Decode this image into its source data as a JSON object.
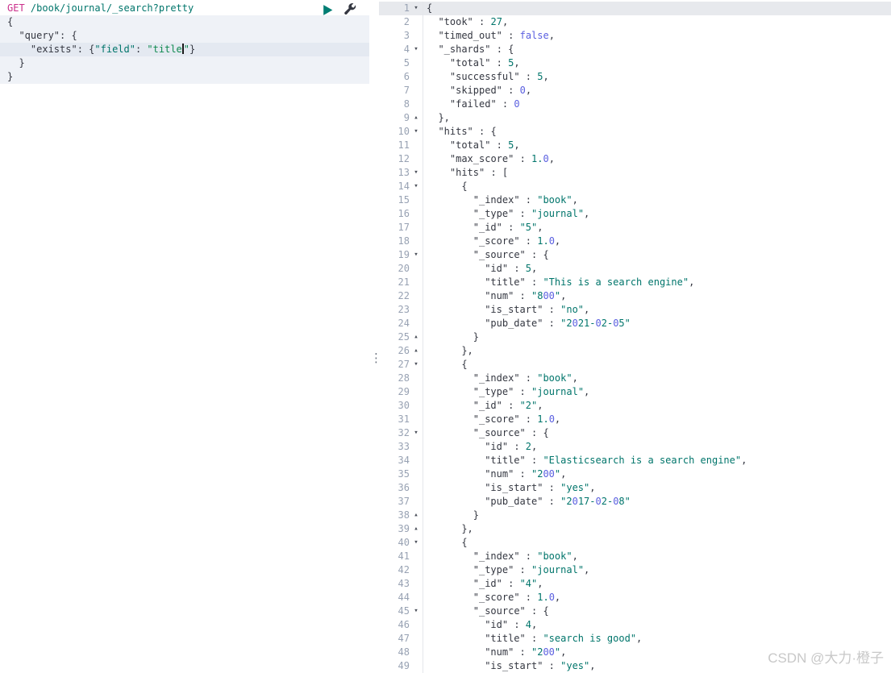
{
  "colors": {
    "method_pink": "#CB2F8B",
    "url_teal": "#00756B",
    "key_dark": "#343741",
    "string_teal": "#00756B",
    "string_green": "#108A50",
    "constant_violet": "#5A5FE0",
    "line_number_grey": "#98A2B3",
    "active_line_bg": "#E7E9ED",
    "play_green": "#017D73"
  },
  "icons": {
    "fold_open": "▾",
    "fold_close": "▴",
    "divider_handle": "⋮",
    "send_request": "play-triangle",
    "settings": "wrench"
  },
  "watermark": "CSDN @大力·橙子",
  "left_editor": {
    "lines": [
      {
        "tokens": [
          [
            "m",
            "GET"
          ],
          [
            "p",
            " "
          ],
          [
            "u",
            "/book/journal/_search?pretty"
          ]
        ]
      },
      {
        "tint": true,
        "tokens": [
          [
            "p",
            "{"
          ]
        ]
      },
      {
        "tint": true,
        "tokens": [
          [
            "p",
            "  "
          ],
          [
            "k",
            "\"query\""
          ],
          [
            "p",
            ": {"
          ]
        ]
      },
      {
        "tint": true,
        "active": true,
        "tokens": [
          [
            "p",
            "    "
          ],
          [
            "k",
            "\"exists\""
          ],
          [
            "p",
            ": {"
          ],
          [
            "f",
            "\"field\""
          ],
          [
            "p",
            ": "
          ],
          [
            "g",
            "\"title"
          ],
          [
            "c",
            ""
          ],
          [
            "g",
            "\""
          ],
          [
            "p",
            "}"
          ]
        ]
      },
      {
        "tint": true,
        "tokens": [
          [
            "p",
            "  }"
          ]
        ]
      },
      {
        "tint": true,
        "tokens": [
          [
            "p",
            "}"
          ]
        ]
      }
    ]
  },
  "right_editor": {
    "lines": [
      {
        "n": 1,
        "fold": "open",
        "indent": 0,
        "active": true,
        "tokens": [
          [
            "p",
            "{"
          ]
        ]
      },
      {
        "n": 2,
        "indent": 2,
        "tokens": [
          [
            "k",
            "\"took\""
          ],
          [
            "p",
            " : "
          ],
          [
            "n",
            "27"
          ],
          [
            "p",
            ","
          ]
        ]
      },
      {
        "n": 3,
        "indent": 2,
        "tokens": [
          [
            "k",
            "\"timed_out\""
          ],
          [
            "p",
            " : "
          ],
          [
            "b",
            "false"
          ],
          [
            "p",
            ","
          ]
        ]
      },
      {
        "n": 4,
        "fold": "open",
        "indent": 2,
        "tokens": [
          [
            "k",
            "\"_shards\""
          ],
          [
            "p",
            " : {"
          ]
        ]
      },
      {
        "n": 5,
        "indent": 4,
        "tokens": [
          [
            "k",
            "\"total\""
          ],
          [
            "p",
            " : "
          ],
          [
            "n",
            "5"
          ],
          [
            "p",
            ","
          ]
        ]
      },
      {
        "n": 6,
        "indent": 4,
        "tokens": [
          [
            "k",
            "\"successful\""
          ],
          [
            "p",
            " : "
          ],
          [
            "n",
            "5"
          ],
          [
            "p",
            ","
          ]
        ]
      },
      {
        "n": 7,
        "indent": 4,
        "tokens": [
          [
            "k",
            "\"skipped\""
          ],
          [
            "p",
            " : "
          ],
          [
            "n",
            "0"
          ],
          [
            "p",
            ","
          ]
        ]
      },
      {
        "n": 8,
        "indent": 4,
        "tokens": [
          [
            "k",
            "\"failed\""
          ],
          [
            "p",
            " : "
          ],
          [
            "n",
            "0"
          ]
        ]
      },
      {
        "n": 9,
        "fold": "close",
        "indent": 2,
        "tokens": [
          [
            "p",
            "},"
          ]
        ]
      },
      {
        "n": 10,
        "fold": "open",
        "indent": 2,
        "tokens": [
          [
            "k",
            "\"hits\""
          ],
          [
            "p",
            " : {"
          ]
        ]
      },
      {
        "n": 11,
        "indent": 4,
        "tokens": [
          [
            "k",
            "\"total\""
          ],
          [
            "p",
            " : "
          ],
          [
            "n",
            "5"
          ],
          [
            "p",
            ","
          ]
        ]
      },
      {
        "n": 12,
        "indent": 4,
        "tokens": [
          [
            "k",
            "\"max_score\""
          ],
          [
            "p",
            " : "
          ],
          [
            "n",
            "1.0"
          ],
          [
            "p",
            ","
          ]
        ]
      },
      {
        "n": 13,
        "fold": "open",
        "indent": 4,
        "tokens": [
          [
            "k",
            "\"hits\""
          ],
          [
            "p",
            " : ["
          ]
        ]
      },
      {
        "n": 14,
        "fold": "open",
        "indent": 6,
        "tokens": [
          [
            "p",
            "{"
          ]
        ]
      },
      {
        "n": 15,
        "indent": 8,
        "tokens": [
          [
            "k",
            "\"_index\""
          ],
          [
            "p",
            " : "
          ],
          [
            "s",
            "\"book\""
          ],
          [
            "p",
            ","
          ]
        ]
      },
      {
        "n": 16,
        "indent": 8,
        "tokens": [
          [
            "k",
            "\"_type\""
          ],
          [
            "p",
            " : "
          ],
          [
            "s",
            "\"journal\""
          ],
          [
            "p",
            ","
          ]
        ]
      },
      {
        "n": 17,
        "indent": 8,
        "tokens": [
          [
            "k",
            "\"_id\""
          ],
          [
            "p",
            " : "
          ],
          [
            "s",
            "\"5\""
          ],
          [
            "p",
            ","
          ]
        ]
      },
      {
        "n": 18,
        "indent": 8,
        "tokens": [
          [
            "k",
            "\"_score\""
          ],
          [
            "p",
            " : "
          ],
          [
            "n",
            "1.0"
          ],
          [
            "p",
            ","
          ]
        ]
      },
      {
        "n": 19,
        "fold": "open",
        "indent": 8,
        "tokens": [
          [
            "k",
            "\"_source\""
          ],
          [
            "p",
            " : {"
          ]
        ]
      },
      {
        "n": 20,
        "indent": 10,
        "tokens": [
          [
            "k",
            "\"id\""
          ],
          [
            "p",
            " : "
          ],
          [
            "n",
            "5"
          ],
          [
            "p",
            ","
          ]
        ]
      },
      {
        "n": 21,
        "indent": 10,
        "tokens": [
          [
            "k",
            "\"title\""
          ],
          [
            "p",
            " : "
          ],
          [
            "s",
            "\"This is a search engine\""
          ],
          [
            "p",
            ","
          ]
        ]
      },
      {
        "n": 22,
        "indent": 10,
        "tokens": [
          [
            "k",
            "\"num\""
          ],
          [
            "p",
            " : "
          ],
          [
            "s",
            "\"800\""
          ],
          [
            "p",
            ","
          ]
        ]
      },
      {
        "n": 23,
        "indent": 10,
        "tokens": [
          [
            "k",
            "\"is_start\""
          ],
          [
            "p",
            " : "
          ],
          [
            "s",
            "\"no\""
          ],
          [
            "p",
            ","
          ]
        ]
      },
      {
        "n": 24,
        "indent": 10,
        "tokens": [
          [
            "k",
            "\"pub_date\""
          ],
          [
            "p",
            " : "
          ],
          [
            "s",
            "\"2021-02-05\""
          ]
        ]
      },
      {
        "n": 25,
        "fold": "close",
        "indent": 8,
        "tokens": [
          [
            "p",
            "}"
          ]
        ]
      },
      {
        "n": 26,
        "fold": "close",
        "indent": 6,
        "tokens": [
          [
            "p",
            "},"
          ]
        ]
      },
      {
        "n": 27,
        "fold": "open",
        "indent": 6,
        "tokens": [
          [
            "p",
            "{"
          ]
        ]
      },
      {
        "n": 28,
        "indent": 8,
        "tokens": [
          [
            "k",
            "\"_index\""
          ],
          [
            "p",
            " : "
          ],
          [
            "s",
            "\"book\""
          ],
          [
            "p",
            ","
          ]
        ]
      },
      {
        "n": 29,
        "indent": 8,
        "tokens": [
          [
            "k",
            "\"_type\""
          ],
          [
            "p",
            " : "
          ],
          [
            "s",
            "\"journal\""
          ],
          [
            "p",
            ","
          ]
        ]
      },
      {
        "n": 30,
        "indent": 8,
        "tokens": [
          [
            "k",
            "\"_id\""
          ],
          [
            "p",
            " : "
          ],
          [
            "s",
            "\"2\""
          ],
          [
            "p",
            ","
          ]
        ]
      },
      {
        "n": 31,
        "indent": 8,
        "tokens": [
          [
            "k",
            "\"_score\""
          ],
          [
            "p",
            " : "
          ],
          [
            "n",
            "1.0"
          ],
          [
            "p",
            ","
          ]
        ]
      },
      {
        "n": 32,
        "fold": "open",
        "indent": 8,
        "tokens": [
          [
            "k",
            "\"_source\""
          ],
          [
            "p",
            " : {"
          ]
        ]
      },
      {
        "n": 33,
        "indent": 10,
        "tokens": [
          [
            "k",
            "\"id\""
          ],
          [
            "p",
            " : "
          ],
          [
            "n",
            "2"
          ],
          [
            "p",
            ","
          ]
        ]
      },
      {
        "n": 34,
        "indent": 10,
        "tokens": [
          [
            "k",
            "\"title\""
          ],
          [
            "p",
            " : "
          ],
          [
            "s",
            "\"Elasticsearch is a search engine\""
          ],
          [
            "p",
            ","
          ]
        ]
      },
      {
        "n": 35,
        "indent": 10,
        "tokens": [
          [
            "k",
            "\"num\""
          ],
          [
            "p",
            " : "
          ],
          [
            "s",
            "\"200\""
          ],
          [
            "p",
            ","
          ]
        ]
      },
      {
        "n": 36,
        "indent": 10,
        "tokens": [
          [
            "k",
            "\"is_start\""
          ],
          [
            "p",
            " : "
          ],
          [
            "s",
            "\"yes\""
          ],
          [
            "p",
            ","
          ]
        ]
      },
      {
        "n": 37,
        "indent": 10,
        "tokens": [
          [
            "k",
            "\"pub_date\""
          ],
          [
            "p",
            " : "
          ],
          [
            "s",
            "\"2017-02-08\""
          ]
        ]
      },
      {
        "n": 38,
        "fold": "close",
        "indent": 8,
        "tokens": [
          [
            "p",
            "}"
          ]
        ]
      },
      {
        "n": 39,
        "fold": "close",
        "indent": 6,
        "tokens": [
          [
            "p",
            "},"
          ]
        ]
      },
      {
        "n": 40,
        "fold": "open",
        "indent": 6,
        "tokens": [
          [
            "p",
            "{"
          ]
        ]
      },
      {
        "n": 41,
        "indent": 8,
        "tokens": [
          [
            "k",
            "\"_index\""
          ],
          [
            "p",
            " : "
          ],
          [
            "s",
            "\"book\""
          ],
          [
            "p",
            ","
          ]
        ]
      },
      {
        "n": 42,
        "indent": 8,
        "tokens": [
          [
            "k",
            "\"_type\""
          ],
          [
            "p",
            " : "
          ],
          [
            "s",
            "\"journal\""
          ],
          [
            "p",
            ","
          ]
        ]
      },
      {
        "n": 43,
        "indent": 8,
        "tokens": [
          [
            "k",
            "\"_id\""
          ],
          [
            "p",
            " : "
          ],
          [
            "s",
            "\"4\""
          ],
          [
            "p",
            ","
          ]
        ]
      },
      {
        "n": 44,
        "indent": 8,
        "tokens": [
          [
            "k",
            "\"_score\""
          ],
          [
            "p",
            " : "
          ],
          [
            "n",
            "1.0"
          ],
          [
            "p",
            ","
          ]
        ]
      },
      {
        "n": 45,
        "fold": "open",
        "indent": 8,
        "tokens": [
          [
            "k",
            "\"_source\""
          ],
          [
            "p",
            " : {"
          ]
        ]
      },
      {
        "n": 46,
        "indent": 10,
        "tokens": [
          [
            "k",
            "\"id\""
          ],
          [
            "p",
            " : "
          ],
          [
            "n",
            "4"
          ],
          [
            "p",
            ","
          ]
        ]
      },
      {
        "n": 47,
        "indent": 10,
        "tokens": [
          [
            "k",
            "\"title\""
          ],
          [
            "p",
            " : "
          ],
          [
            "s",
            "\"search is good\""
          ],
          [
            "p",
            ","
          ]
        ]
      },
      {
        "n": 48,
        "indent": 10,
        "tokens": [
          [
            "k",
            "\"num\""
          ],
          [
            "p",
            " : "
          ],
          [
            "s",
            "\"200\""
          ],
          [
            "p",
            ","
          ]
        ]
      },
      {
        "n": 49,
        "indent": 10,
        "tokens": [
          [
            "k",
            "\"is_start\""
          ],
          [
            "p",
            " : "
          ],
          [
            "s",
            "\"yes\""
          ],
          [
            "p",
            ","
          ]
        ]
      }
    ]
  }
}
